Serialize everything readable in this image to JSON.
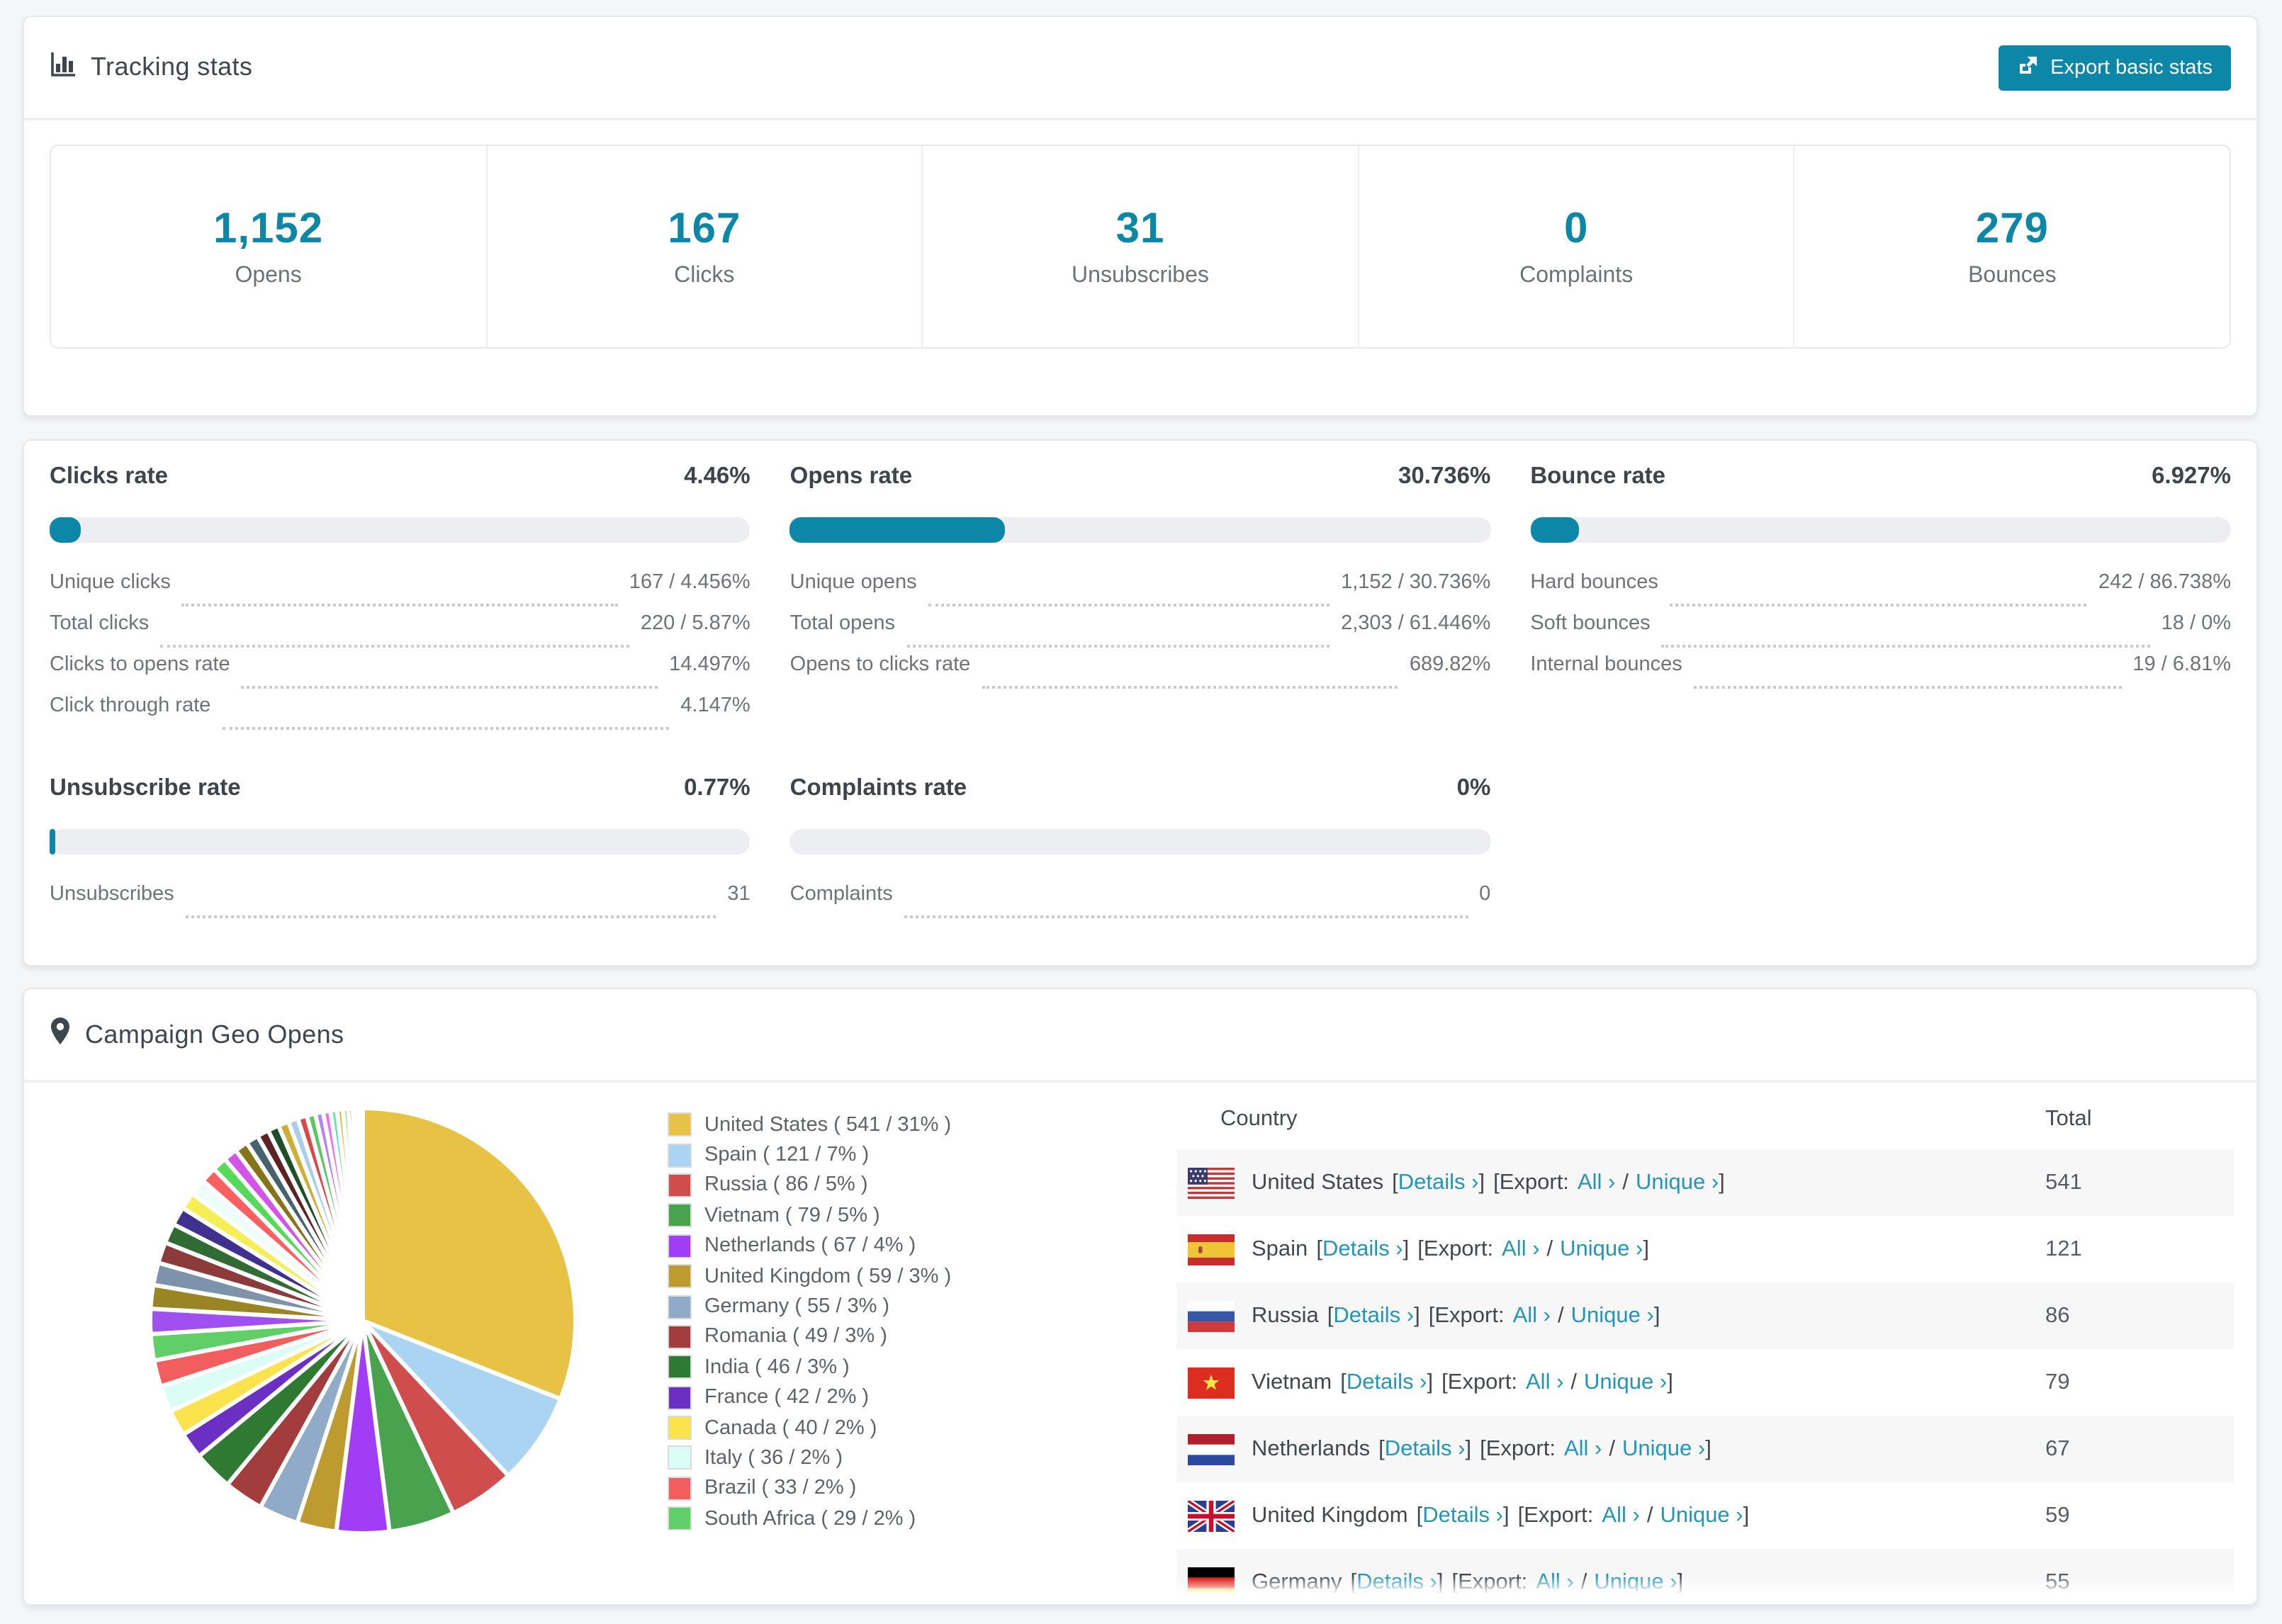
{
  "colors": {
    "accent_teal": "#0d87a7",
    "link_teal": "#2196ba",
    "title_text": "#40464d",
    "muted_text": "#6c7277",
    "bar_track": "#eceef2",
    "row_stripe": "#f7f7f8",
    "page_bg": "#f5f6f8"
  },
  "tracking": {
    "title": "Tracking stats",
    "export_button": "Export basic stats",
    "stats": [
      {
        "value": "1,152",
        "label": "Opens"
      },
      {
        "value": "167",
        "label": "Clicks"
      },
      {
        "value": "31",
        "label": "Unsubscribes"
      },
      {
        "value": "0",
        "label": "Complaints"
      },
      {
        "value": "279",
        "label": "Bounces"
      }
    ]
  },
  "rates": {
    "blocks": [
      {
        "title": "Clicks rate",
        "value": "4.46%",
        "percent": 4.46,
        "rows": [
          {
            "label": "Unique clicks",
            "value": "167 / 4.456%"
          },
          {
            "label": "Total clicks",
            "value": "220 / 5.87%"
          },
          {
            "label": "Clicks to opens rate",
            "value": "14.497%"
          },
          {
            "label": "Click through rate",
            "value": "4.147%"
          }
        ]
      },
      {
        "title": "Opens rate",
        "value": "30.736%",
        "percent": 30.736,
        "rows": [
          {
            "label": "Unique opens",
            "value": "1,152 / 30.736%"
          },
          {
            "label": "Total opens",
            "value": "2,303 / 61.446%"
          },
          {
            "label": "Opens to clicks rate",
            "value": "689.82%"
          }
        ]
      },
      {
        "title": "Bounce rate",
        "value": "6.927%",
        "percent": 6.927,
        "rows": [
          {
            "label": "Hard bounces",
            "value": "242 / 86.738%"
          },
          {
            "label": "Soft bounces",
            "value": "18 / 0%"
          },
          {
            "label": "Internal bounces",
            "value": "19 / 6.81%"
          }
        ]
      },
      {
        "title": "Unsubscribe rate",
        "value": "0.77%",
        "percent": 0.77,
        "rows": [
          {
            "label": "Unsubscribes",
            "value": "31"
          }
        ]
      },
      {
        "title": "Complaints rate",
        "value": "0%",
        "percent": 0,
        "rows": [
          {
            "label": "Complaints",
            "value": "0"
          }
        ]
      }
    ]
  },
  "geo": {
    "title": "Campaign Geo Opens",
    "legend": [
      {
        "label": "United States ( 541 / 31% )",
        "color": "#e7c244"
      },
      {
        "label": "Spain ( 121 / 7% )",
        "color": "#abd3f2"
      },
      {
        "label": "Russia ( 86 / 5% )",
        "color": "#cf4d4d"
      },
      {
        "label": "Vietnam ( 79 / 5% )",
        "color": "#49a24e"
      },
      {
        "label": "Netherlands ( 67 / 4% )",
        "color": "#a13ef5"
      },
      {
        "label": "United Kingdom ( 59 / 3% )",
        "color": "#bd9b2e"
      },
      {
        "label": "Germany ( 55 / 3% )",
        "color": "#8fabc8"
      },
      {
        "label": "Romania ( 49 / 3% )",
        "color": "#a33d3d"
      },
      {
        "label": "India ( 46 / 3% )",
        "color": "#2f7a33"
      },
      {
        "label": "France ( 42 / 2% )",
        "color": "#6c2fc4"
      },
      {
        "label": "Canada ( 40 / 2% )",
        "color": "#fbe34d"
      },
      {
        "label": "Italy ( 36 / 2% )",
        "color": "#dcfcf6"
      },
      {
        "label": "Brazil ( 33 / 2% )",
        "color": "#f25e5e"
      },
      {
        "label": "South Africa ( 29 / 2% )",
        "color": "#61cf67"
      }
    ],
    "table": {
      "columns": [
        "Country",
        "Total"
      ],
      "link_labels": {
        "bracket_open": "[",
        "details": "Details ›",
        "bracket_close": "]",
        "export_open": "[Export:",
        "all": "All ›",
        "slash": "/",
        "unique": "Unique ›",
        "export_close": "]"
      },
      "rows": [
        {
          "country": "United States",
          "total": "541"
        },
        {
          "country": "Spain",
          "total": "121"
        },
        {
          "country": "Russia",
          "total": "86"
        },
        {
          "country": "Vietnam",
          "total": "79"
        },
        {
          "country": "Netherlands",
          "total": "67"
        },
        {
          "country": "United Kingdom",
          "total": "59"
        },
        {
          "country": "Germany",
          "total": "55"
        }
      ]
    }
  },
  "chart_data": {
    "type": "pie",
    "title": "Campaign Geo Opens",
    "unit": "opens",
    "start_angle_deg": 0,
    "direction": "clockwise",
    "legend_position": "right",
    "slices": [
      {
        "label": "United States",
        "value": 541,
        "pct": 31,
        "color": "#e7c244"
      },
      {
        "label": "Spain",
        "value": 121,
        "pct": 7,
        "color": "#abd3f2"
      },
      {
        "label": "Russia",
        "value": 86,
        "pct": 5,
        "color": "#cf4d4d"
      },
      {
        "label": "Vietnam",
        "value": 79,
        "pct": 5,
        "color": "#49a24e"
      },
      {
        "label": "Netherlands",
        "value": 67,
        "pct": 4,
        "color": "#a13ef5"
      },
      {
        "label": "United Kingdom",
        "value": 59,
        "pct": 3,
        "color": "#bd9b2e"
      },
      {
        "label": "Germany",
        "value": 55,
        "pct": 3,
        "color": "#8fabc8"
      },
      {
        "label": "Romania",
        "value": 49,
        "pct": 3,
        "color": "#a33d3d"
      },
      {
        "label": "India",
        "value": 46,
        "pct": 3,
        "color": "#2f7a33"
      },
      {
        "label": "France",
        "value": 42,
        "pct": 2,
        "color": "#6c2fc4"
      },
      {
        "label": "Canada",
        "value": 40,
        "pct": 2,
        "color": "#fbe34d"
      },
      {
        "label": "Italy",
        "value": 36,
        "pct": 2,
        "color": "#dcfcf6"
      },
      {
        "label": "Brazil",
        "value": 33,
        "pct": 2,
        "color": "#f25e5e"
      },
      {
        "label": "South Africa",
        "value": 29,
        "pct": 2,
        "color": "#61cf67"
      }
    ],
    "unlabeled_slices": [
      {
        "pct": 1.9,
        "color": "#a04ff0"
      },
      {
        "pct": 1.8,
        "color": "#9a8524"
      },
      {
        "pct": 1.7,
        "color": "#7c93ab"
      },
      {
        "pct": 1.6,
        "color": "#8c3a3a"
      },
      {
        "pct": 1.5,
        "color": "#2f6b33"
      },
      {
        "pct": 1.4,
        "color": "#403090"
      },
      {
        "pct": 1.3,
        "color": "#f5ee55"
      },
      {
        "pct": 1.25,
        "color": "#ecfdfb"
      },
      {
        "pct": 1.2,
        "color": "#fa6060"
      },
      {
        "pct": 1.1,
        "color": "#54da58"
      },
      {
        "pct": 1.05,
        "color": "#d453e8"
      },
      {
        "pct": 1.0,
        "color": "#857418"
      },
      {
        "pct": 0.95,
        "color": "#46626e"
      },
      {
        "pct": 0.9,
        "color": "#5e2222"
      },
      {
        "pct": 0.85,
        "color": "#1e4f26"
      },
      {
        "pct": 0.8,
        "color": "#cfae35"
      },
      {
        "pct": 0.75,
        "color": "#a9cdec"
      },
      {
        "pct": 0.7,
        "color": "#dc4848"
      },
      {
        "pct": 0.65,
        "color": "#5bc763"
      },
      {
        "pct": 0.6,
        "color": "#b285f0"
      },
      {
        "pct": 0.55,
        "color": "#ef6ff0"
      },
      {
        "pct": 0.5,
        "color": "#66e0b8"
      },
      {
        "pct": 0.45,
        "color": "#e0b840"
      },
      {
        "pct": 0.4,
        "color": "#90e050"
      },
      {
        "pct": 0.35,
        "color": "#e05090"
      },
      {
        "pct": 0.3,
        "color": "#5090e0"
      },
      {
        "pct": 0.25,
        "color": "#c0c0f8"
      },
      {
        "pct": 0.2,
        "color": "#e8e8e8"
      }
    ]
  }
}
